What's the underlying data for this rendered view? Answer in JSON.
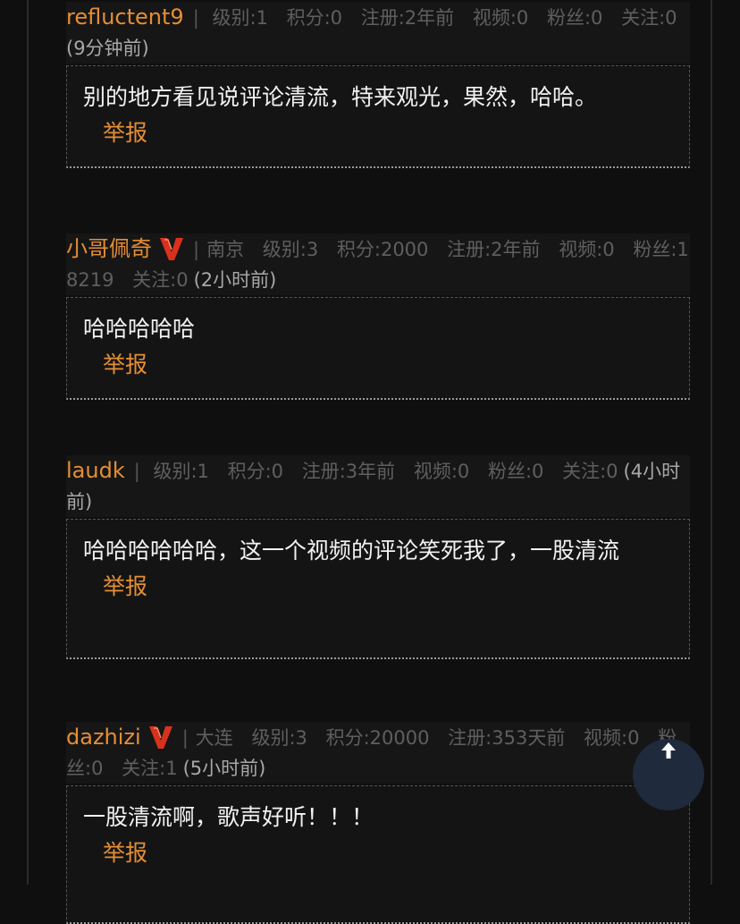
{
  "comments": [
    {
      "username": "refluctent9",
      "has_v_badge": false,
      "location": "",
      "level": "级别:1",
      "points": "积分:0",
      "registered": "注册:2年前",
      "videos": "视频:0",
      "fans": "粉丝:0",
      "follows": "关注:0",
      "time": "(9分钟前)",
      "text": "别的地方看见说评论清流，特来观光，果然，哈哈。",
      "report_label": "举报"
    },
    {
      "username": "小哥佩奇",
      "has_v_badge": true,
      "location": "南京",
      "level": "级别:3",
      "points": "积分:2000",
      "registered": "注册:2年前",
      "videos": "视频:0",
      "fans": "粉丝:18219",
      "follows": "关注:0",
      "time": "(2小时前)",
      "text": "哈哈哈哈哈",
      "report_label": "举报"
    },
    {
      "username": "laudk",
      "has_v_badge": false,
      "location": "",
      "level": "级别:1",
      "points": "积分:0",
      "registered": "注册:3年前",
      "videos": "视频:0",
      "fans": "粉丝:0",
      "follows": "关注:0",
      "time": "(4小时前)",
      "text": "哈哈哈哈哈哈，这一个视频的评论笑死我了，一股清流",
      "report_label": "举报"
    },
    {
      "username": "dazhizi",
      "has_v_badge": true,
      "location": "大连",
      "level": "级别:3",
      "points": "积分:20000",
      "registered": "注册:353天前",
      "videos": "视频:0",
      "fans": "粉丝:0",
      "follows": "关注:1",
      "time": "(5小时前)",
      "text": "一股清流啊，歌声好听！！！",
      "report_label": "举报"
    }
  ],
  "colors": {
    "username": "#e58e35",
    "report": "#e58e35",
    "meta": "#5f5f5f",
    "badge": "#d8321f",
    "back_to_top_bg": "#1f2a3c"
  },
  "back_to_top": {
    "icon": "arrow-up-icon"
  }
}
